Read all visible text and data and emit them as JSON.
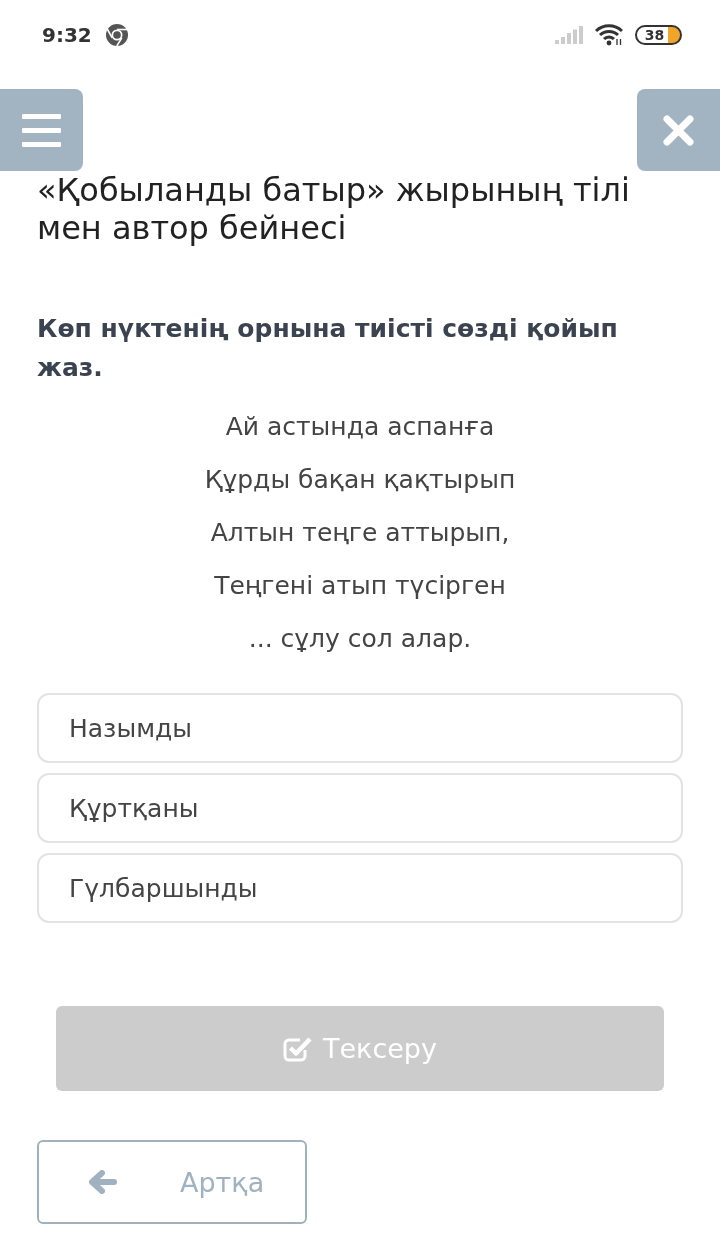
{
  "status_bar": {
    "time": "9:32",
    "battery": "38"
  },
  "lesson": {
    "title": "«Қобыланды батыр» жырының тілі мен автор бейнесі"
  },
  "question": {
    "instruction": "Көп нүктенің орнына тиісті сөзді қойып жаз.",
    "poem_lines": [
      "Ай астында аспанға",
      "Құрды бақан қақтырып",
      "Алтын теңге аттырып,",
      "Теңгені атып түсірген",
      "... сұлу сол алар."
    ]
  },
  "options": [
    {
      "label": "Назымды",
      "selected": false
    },
    {
      "label": "Құртқаны",
      "selected": false
    },
    {
      "label": "Гүлбаршынды",
      "selected": false
    }
  ],
  "check_button": {
    "label": "Тексеру",
    "disabled": true
  },
  "back_button": {
    "label": "Артқа"
  }
}
